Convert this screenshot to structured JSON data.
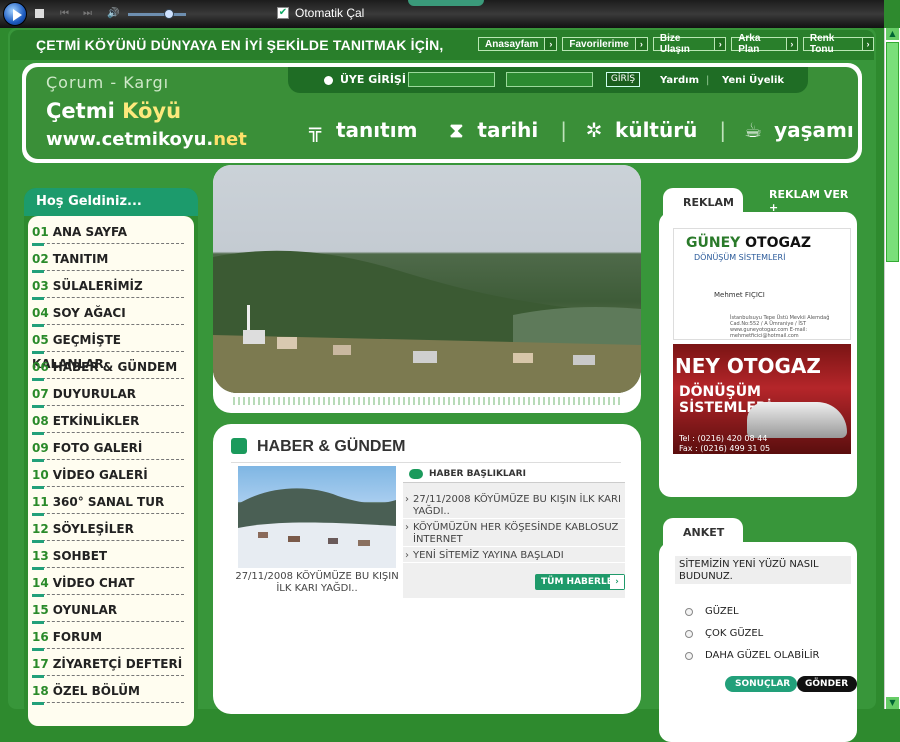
{
  "player": {
    "autoplay_label": "Otomatik Çal",
    "autoplay_checked": true,
    "volume": 0.63
  },
  "slogan": "ÇETMİ KÖYÜNÜ DÜNYAYA EN İYİ ŞEKİLDE TANITMAK İÇİN,",
  "topnav": [
    "Anasayfam",
    "Favorilerime",
    "Bize Ulaşın",
    "Arka Plan",
    "Renk Tonu"
  ],
  "brand": {
    "line1": "Çorum - Kargı",
    "line2a": "Çetmi",
    "line2b": "Köyü",
    "line3a": "www.cetmikoyu.",
    "line3b": "net"
  },
  "login": {
    "label": "ÜYE GİRİŞİ",
    "button": "GİRİŞ",
    "help": "Yardım",
    "sep": "|",
    "register": "Yeni Üyelik"
  },
  "menu": [
    {
      "label": "tanıtım",
      "icon": "podium-icon"
    },
    {
      "label": "tarihi",
      "icon": "hourglass-icon"
    },
    {
      "label": "kültürü",
      "icon": "gear-icon"
    },
    {
      "label": "yaşamı",
      "icon": "cup-icon"
    }
  ],
  "menu_sep": "|",
  "sidebar": {
    "title": "Hoş Geldiniz...",
    "items": [
      {
        "num": "01",
        "label": "ANA SAYFA"
      },
      {
        "num": "02",
        "label": "TANITIM"
      },
      {
        "num": "03",
        "label": "SÜLALERİMİZ"
      },
      {
        "num": "04",
        "label": "SOY AĞACI"
      },
      {
        "num": "05",
        "label": "GEÇMİŞTE KALANLAR"
      },
      {
        "num": "06",
        "label": "HABER & GÜNDEM"
      },
      {
        "num": "07",
        "label": "DUYURULAR"
      },
      {
        "num": "08",
        "label": "ETKİNLİKLER"
      },
      {
        "num": "09",
        "label": "FOTO GALERİ"
      },
      {
        "num": "10",
        "label": "VİDEO GALERİ"
      },
      {
        "num": "11",
        "label": "360° SANAL TUR"
      },
      {
        "num": "12",
        "label": "SÖYLEŞİLER"
      },
      {
        "num": "13",
        "label": "SOHBET"
      },
      {
        "num": "14",
        "label": "VİDEO CHAT"
      },
      {
        "num": "15",
        "label": "OYUNLAR"
      },
      {
        "num": "16",
        "label": "FORUM"
      },
      {
        "num": "17",
        "label": "ZİYARETÇİ DEFTERİ"
      },
      {
        "num": "18",
        "label": "ÖZEL BÖLÜM"
      }
    ]
  },
  "news": {
    "title": "HABER & GÜNDEM",
    "image_caption": "27/11/2008 KÖYÜMÜZE BU KIŞIN İLK KARI YAĞDI..",
    "headlines_title": "HABER BAŞLIKLARI",
    "headlines": [
      "27/11/2008 KÖYÜMÜZE BU KIŞIN İLK KARI YAĞDI..",
      "KÖYÜMÜZÜN HER KÖŞESİNDE KABLOSUZ İNTERNET",
      "YENİ SİTEMİZ YAYINA BAŞLADI"
    ],
    "all_button": "TÜM HABERLER"
  },
  "ad": {
    "tab": "REKLAM",
    "extra": "REKLAM VER +",
    "card1_title_a": "GÜNEY",
    "card1_title_b": "OTOGAZ",
    "card1_sub": "DÖNÜŞÜM SİSTEMLERİ",
    "card1_name": "Mehmet FIÇICI",
    "card1_address": "İstanbulsuyu Tepe Üstü Mevkii Alemdağ Cad.No:552 / A Ümraniye / İST www.guneyotogaz.com E-mail: mehmetficici@hotmail.com",
    "card2_title": "NEY OTOGAZ",
    "card2_sub": "DÖNÜŞÜM SİSTEMLERİ",
    "card2_phone": "Tel : (0216) 420 08 44",
    "card2_fax": "Fax : (0216) 499 31 05"
  },
  "poll": {
    "tab": "ANKET",
    "question": "SİTEMİZİN YENİ YÜZÜ NASIL BUDUNUZ.",
    "options": [
      "GÜZEL",
      "ÇOK GÜZEL",
      "DAHA GÜZEL OLABİLİR"
    ],
    "results_button": "SONUÇLAR",
    "send_button": "GÖNDER"
  },
  "colors": {
    "page_bg": "#2e8a2e",
    "accent": "#1c9b6c",
    "dark_green": "#1f6d25"
  }
}
